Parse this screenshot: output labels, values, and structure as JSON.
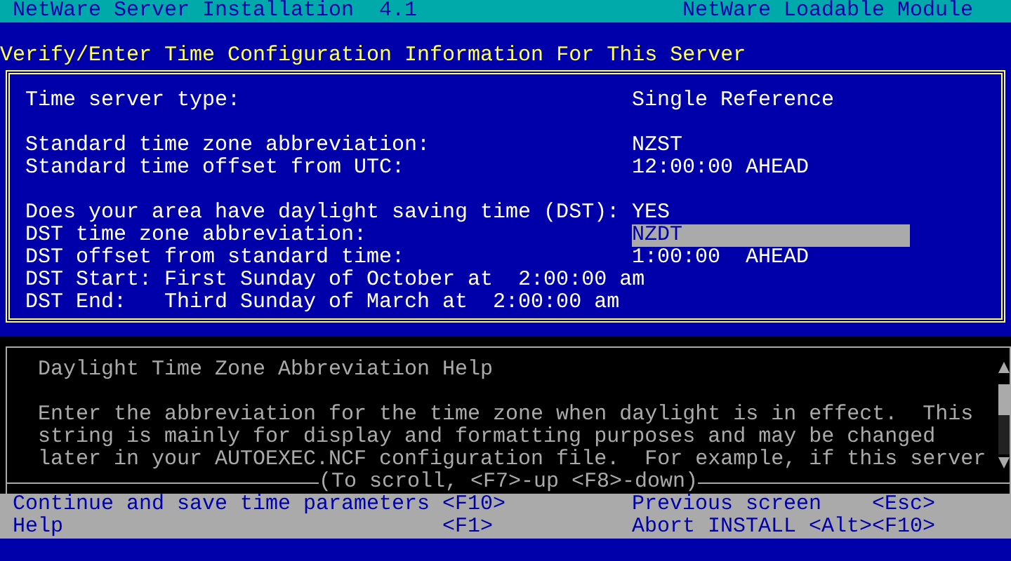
{
  "header": {
    "title": "NetWare Server Installation  4.1",
    "module": "NetWare Loadable Module"
  },
  "screen_title": "Verify/Enter Time Configuration Information For This Server",
  "sections": [
    [
      {
        "kind": "field",
        "label": "Time server type:",
        "value": "Single Reference",
        "selected": false
      }
    ],
    [
      {
        "kind": "field",
        "label": "Standard time zone abbreviation:",
        "value": "NZST",
        "selected": false
      },
      {
        "kind": "field",
        "label": "Standard time offset from UTC:",
        "value": "12:00:00 AHEAD",
        "selected": false
      }
    ],
    [
      {
        "kind": "field",
        "label": "Does your area have daylight saving time (DST):",
        "value": "YES",
        "selected": false
      },
      {
        "kind": "field",
        "label": "DST time zone abbreviation:",
        "value": "NZDT",
        "selected": true
      },
      {
        "kind": "field",
        "label": "DST offset from standard time:",
        "value": "1:00:00  AHEAD",
        "selected": false
      },
      {
        "kind": "line",
        "text": "DST Start: First Sunday of October at  2:00:00 am"
      },
      {
        "kind": "line",
        "text": "DST End:   Third Sunday of March at  2:00:00 am"
      }
    ]
  ],
  "help": {
    "title": "Daylight Time Zone Abbreviation Help",
    "text": "Enter the abbreviation for the time zone when daylight is in effect.  This\nstring is mainly for display and formatting purposes and may be changed\nlater in your AUTOEXEC.NCF configuration file.  For example, if this server",
    "scroll_hint": "(To scroll, <F7>-up <F8>-down)"
  },
  "keys": [
    {
      "label": "Continue and save time parameters",
      "key": "<F10>"
    },
    {
      "label": "Previous screen",
      "key": "<Esc>"
    },
    {
      "label": "Help",
      "key": "<F1>"
    },
    {
      "label": "Abort INSTALL",
      "key": "<Alt><F10>"
    }
  ]
}
